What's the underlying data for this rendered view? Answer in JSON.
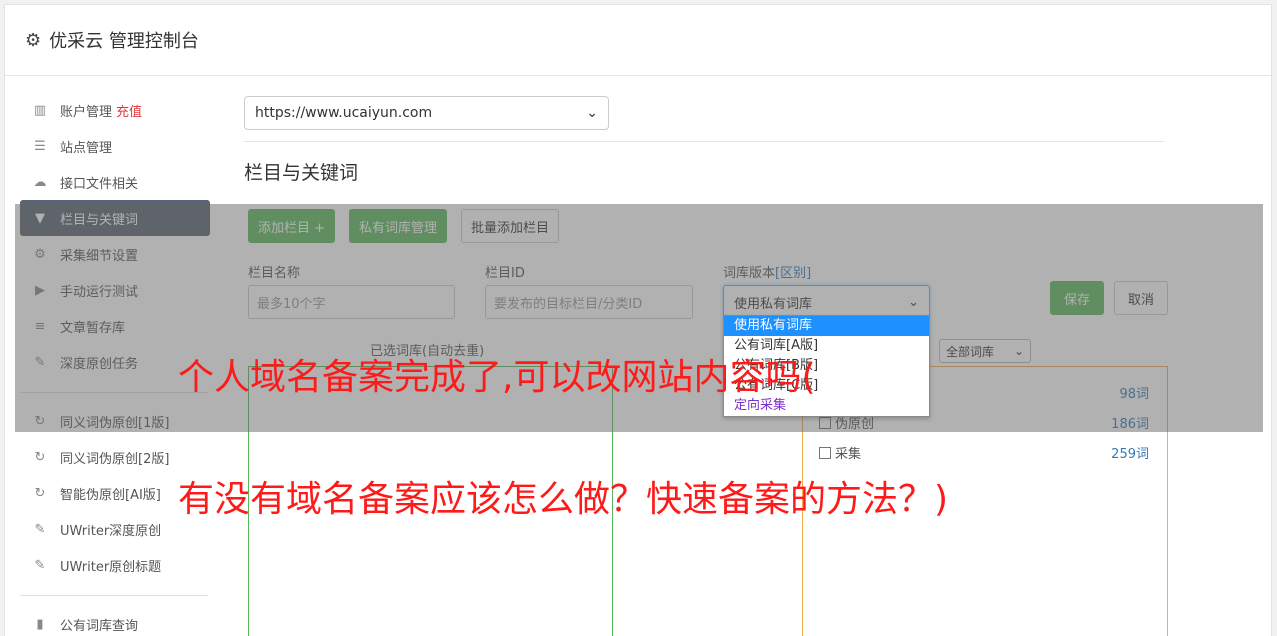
{
  "header": {
    "title": "优采云 管理控制台",
    "icon": "gear-icon"
  },
  "sidebar": {
    "items": [
      {
        "label": "账户管理",
        "extra": "充值",
        "icon": "bar-chart-icon"
      },
      {
        "label": "站点管理",
        "icon": "server-icon"
      },
      {
        "label": "接口文件相关",
        "icon": "cloud-upload-icon"
      },
      {
        "label": "栏目与关键词",
        "icon": "filter-icon",
        "active": true
      },
      {
        "label": "采集细节设置",
        "icon": "cogs-icon"
      },
      {
        "label": "手动运行测试",
        "icon": "play-circle-icon"
      },
      {
        "label": "文章暂存库",
        "icon": "database-icon"
      },
      {
        "label": "深度原创任务",
        "icon": "edit-icon"
      }
    ],
    "items2": [
      {
        "label": "同义词伪原创[1版]",
        "icon": "refresh-icon"
      },
      {
        "label": "同义词伪原创[2版]",
        "icon": "refresh-icon"
      },
      {
        "label": "智能伪原创[AI版]",
        "icon": "refresh-icon"
      },
      {
        "label": "UWriter深度原创",
        "icon": "edit-icon"
      },
      {
        "label": "UWriter原创标题",
        "icon": "edit-icon"
      }
    ],
    "items3": [
      {
        "label": "公有词库查询",
        "icon": "book-icon"
      }
    ]
  },
  "main": {
    "site_select": "https://www.ucaiyun.com",
    "section_title": "栏目与关键词",
    "toolbar": {
      "add_column": "添加栏目 +",
      "private_lib": "私有词库管理",
      "batch_add": "批量添加栏目"
    },
    "form": {
      "name_label": "栏目名称",
      "name_placeholder": "最多10个字",
      "id_label": "栏目ID",
      "id_placeholder": "要发布的目标栏目/分类ID",
      "version_label": "词库版本",
      "version_link": "[区别]",
      "version_value": "使用私有词库",
      "save": "保存",
      "cancel": "取消"
    },
    "selected_label": "已选词库(自动去重)",
    "filter_value": "全部词库",
    "dropdown": [
      "使用私有词库",
      "公有词库[A版]",
      "公有词库[B版]",
      "公有词库[C版]",
      "定向采集"
    ],
    "libs": [
      {
        "name": "",
        "count": "98词"
      },
      {
        "name": "伪原创",
        "count": "186词"
      },
      {
        "name": "采集",
        "count": "259词"
      }
    ]
  },
  "captions": {
    "line1": "个人域名备案完成了,可以改网站内容吗(",
    "line2": "有没有域名备案应该怎么做？快速备案的方法？)"
  },
  "colors": {
    "green": "#5cb85c",
    "active_nav": "#5b6472",
    "caption": "#ff1a1a",
    "link": "#337ab7"
  }
}
